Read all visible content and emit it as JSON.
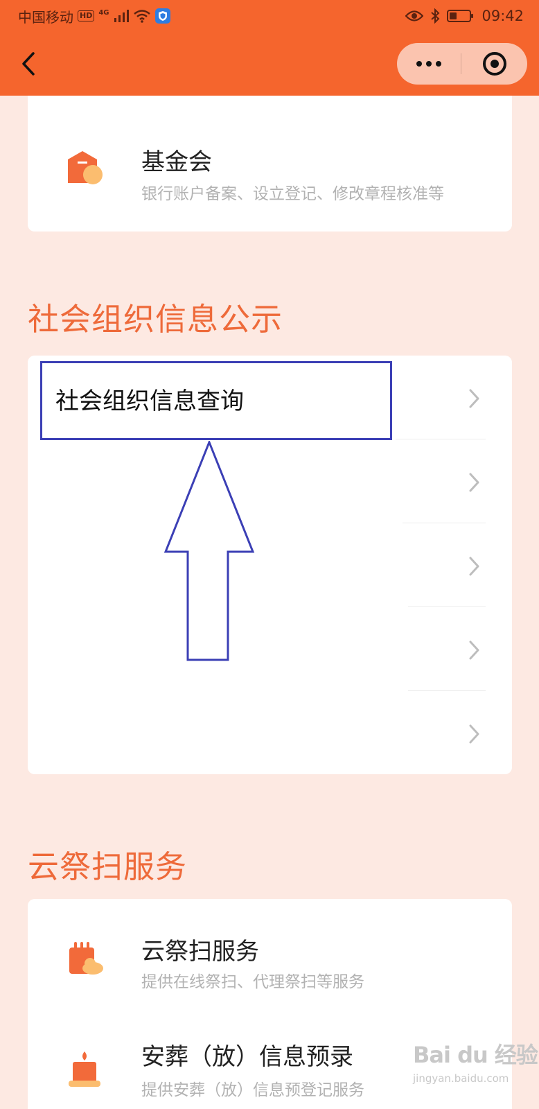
{
  "status_bar": {
    "carrier": "中国移动",
    "hd_badge": "HD",
    "network": "4G",
    "time": "09:42",
    "icons": [
      "signal-icon",
      "wifi-icon",
      "shield-app-icon",
      "eye-icon",
      "bluetooth-icon",
      "battery-icon"
    ]
  },
  "nav": {
    "back_icon": "chevron-left-icon",
    "menu_icon": "more-dots-icon",
    "close_icon": "target-circle-icon"
  },
  "colors": {
    "header": "#f5652d",
    "page_bg": "#fde9e2",
    "accent": "#ee6a3a",
    "annotation": "#3b3fb5"
  },
  "foundation_card": {
    "title": "基金会",
    "description": "银行账户备案、设立登记、修改章程核准等",
    "icon": "foundation-building-icon"
  },
  "info_section": {
    "title": "社会组织信息公示",
    "items": [
      {
        "label": "社会组织信息查询"
      },
      {
        "label": ""
      },
      {
        "label": ""
      },
      {
        "label": ""
      },
      {
        "label": ""
      }
    ]
  },
  "annotation": {
    "box_label": "社会组织信息查询",
    "arrow": "up-arrow-outline"
  },
  "memorial_section": {
    "title": "云祭扫服务",
    "items": [
      {
        "title": "云祭扫服务",
        "description": "提供在线祭扫、代理祭扫等服务",
        "icon": "memorial-calendar-icon"
      },
      {
        "title": "安葬（放）信息预录",
        "description": "提供安葬（放）信息预登记服务",
        "icon": "candle-icon"
      }
    ]
  },
  "watermark": {
    "brand": "Bai du 经验",
    "url": "jingyan.baidu.com"
  }
}
